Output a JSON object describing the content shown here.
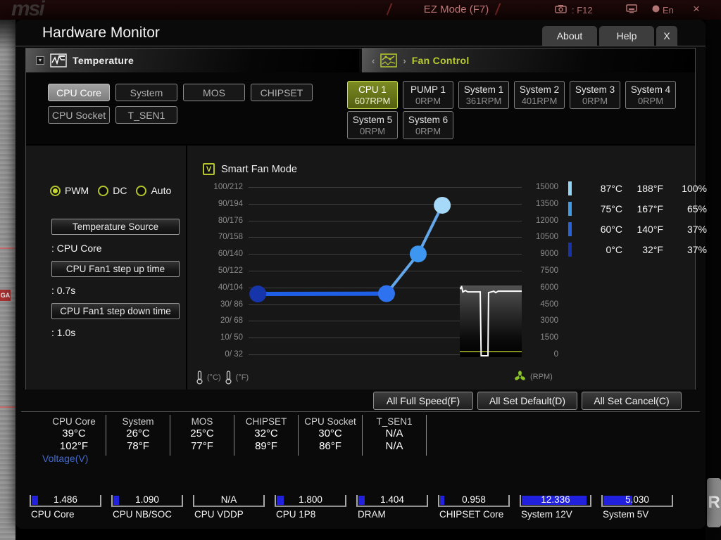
{
  "background": {
    "logo": "msi",
    "ez_mode": "EZ Mode (F7)",
    "screenshot_hint": ": F12",
    "lang": "En",
    "close_glyph": "×",
    "ga_badge": "GA",
    "r_letter": "R"
  },
  "window": {
    "title": "Hardware Monitor",
    "tabs": [
      {
        "label": "About",
        "x": false
      },
      {
        "label": "Help",
        "x": false
      },
      {
        "label": "X",
        "x": true
      }
    ]
  },
  "sections": {
    "temperature": {
      "label": "Temperature",
      "expander_glyph": "▾"
    },
    "fan_control": {
      "label": "Fan Control",
      "chev_left": "‹",
      "chev_right": "›"
    }
  },
  "temp_sensors": {
    "items": [
      {
        "label": "CPU Core",
        "selected": true
      },
      {
        "label": "System",
        "selected": false
      },
      {
        "label": "MOS",
        "selected": false
      },
      {
        "label": "CHIPSET",
        "selected": false
      },
      {
        "label": "CPU Socket",
        "selected": false
      },
      {
        "label": "T_SEN1",
        "selected": false
      }
    ]
  },
  "fans": {
    "items": [
      {
        "name": "CPU 1",
        "rpm": "607RPM",
        "selected": true
      },
      {
        "name": "PUMP 1",
        "rpm": "0RPM",
        "selected": false
      },
      {
        "name": "System 1",
        "rpm": "361RPM",
        "selected": false
      },
      {
        "name": "System 2",
        "rpm": "401RPM",
        "selected": false
      },
      {
        "name": "System 3",
        "rpm": "0RPM",
        "selected": false
      },
      {
        "name": "System 4",
        "rpm": "0RPM",
        "selected": false
      },
      {
        "name": "System 5",
        "rpm": "0RPM",
        "selected": false
      },
      {
        "name": "System 6",
        "rpm": "0RPM",
        "selected": false
      }
    ]
  },
  "fan_settings": {
    "modes": [
      {
        "label": "PWM",
        "selected": true
      },
      {
        "label": "DC",
        "selected": false
      },
      {
        "label": "Auto",
        "selected": false
      }
    ],
    "fields": [
      {
        "label": "Temperature Source",
        "value": ": CPU Core"
      },
      {
        "label": "CPU Fan1 step up time",
        "value": ": 0.7s"
      },
      {
        "label": "CPU Fan1 step down time",
        "value": ": 1.0s"
      }
    ]
  },
  "chart_data": {
    "type": "line",
    "title": "Smart Fan Mode",
    "checkbox_glyph": "V",
    "checkbox_checked": true,
    "x_axis": "temperature",
    "y_axis_left": "temperature °C/°F",
    "y_axis_right": "fan speed RPM",
    "y_left_range": [
      0,
      100
    ],
    "y_right_range": [
      0,
      15000
    ],
    "grid": true,
    "axis_rows": [
      {
        "l": "100/212",
        "r": "15000"
      },
      {
        "l": "90/194",
        "r": "13500"
      },
      {
        "l": "80/176",
        "r": "12000"
      },
      {
        "l": "70/158",
        "r": "10500"
      },
      {
        "l": "60/140",
        "r": "9000"
      },
      {
        "l": "50/122",
        "r": "7500"
      },
      {
        "l": "40/104",
        "r": "6000"
      },
      {
        "l": "30/ 86",
        "r": "4500"
      },
      {
        "l": "20/ 68",
        "r": "3000"
      },
      {
        "l": "10/ 50",
        "r": "1500"
      },
      {
        "l": "0/ 32",
        "r": "0"
      }
    ],
    "points": [
      {
        "temp_c": 0,
        "temp_f": 32,
        "fan_pct": 37,
        "color": "#1635aa",
        "px": 0.034,
        "py": 0.639
      },
      {
        "temp_c": 60,
        "temp_f": 140,
        "fan_pct": 37,
        "color": "#2e72f0",
        "px": 0.505,
        "py": 0.637
      },
      {
        "temp_c": 75,
        "temp_f": 167,
        "fan_pct": 65,
        "color": "#3d96f0",
        "px": 0.621,
        "py": 0.4
      },
      {
        "temp_c": 87,
        "temp_f": 188,
        "fan_pct": 100,
        "color": "#a6d8f8",
        "px": 0.709,
        "py": 0.109
      }
    ],
    "segment_colors": {
      "low": "#1f5fe6",
      "high": "#63a7e8"
    },
    "point_radius": 12,
    "legend_rows": [
      {
        "c": "87°C",
        "f": "188°F",
        "p": "100%",
        "color": "#90d5f5"
      },
      {
        "c": "75°C",
        "f": "167°F",
        "p": "65%",
        "color": "#3f9ae8"
      },
      {
        "c": "60°C",
        "f": "140°F",
        "p": "37%",
        "color": "#2463d8"
      },
      {
        "c": "0°C",
        "f": "32°F",
        "p": "37%",
        "color": "#1733a8"
      }
    ],
    "units": {
      "celsius": "(°C)",
      "fahrenheit": "(°F)",
      "rpm": "(RPM)"
    },
    "rpm_history": {
      "line_color": "#ffffff",
      "baseline_color": "#aab928",
      "baseline_frac": 0.92,
      "points": [
        [
          0,
          0.05
        ],
        [
          0.03,
          0.02
        ],
        [
          0.05,
          0.09
        ],
        [
          0.09,
          0.07
        ],
        [
          0.13,
          0.09
        ],
        [
          0.3,
          0.09
        ],
        [
          0.33,
          0.09
        ],
        [
          0.345,
          0.98
        ],
        [
          0.455,
          0.98
        ],
        [
          0.465,
          0.1
        ],
        [
          0.55,
          0.08
        ],
        [
          0.58,
          0.1
        ],
        [
          0.62,
          0.08
        ],
        [
          1,
          0.08
        ]
      ]
    }
  },
  "action_buttons": [
    "All Full Speed(F)",
    "All Set Default(D)",
    "All Set Cancel(C)"
  ],
  "temp_readouts": [
    {
      "name": "CPU Core",
      "c": "39°C",
      "f": "102°F"
    },
    {
      "name": "System",
      "c": "26°C",
      "f": "78°F"
    },
    {
      "name": "MOS",
      "c": "25°C",
      "f": "77°F"
    },
    {
      "name": "CHIPSET",
      "c": "32°C",
      "f": "89°F"
    },
    {
      "name": "CPU Socket",
      "c": "30°C",
      "f": "86°F"
    },
    {
      "name": "T_SEN1",
      "c": "N/A",
      "f": "N/A"
    }
  ],
  "voltage": {
    "title": "Voltage(V)",
    "items": [
      {
        "name": "CPU Core",
        "value": "1.486",
        "fill_pct": 9
      },
      {
        "name": "CPU NB/SOC",
        "value": "1.090",
        "fill_pct": 8
      },
      {
        "name": "CPU VDDP",
        "value": "N/A",
        "fill_pct": 0
      },
      {
        "name": "CPU 1P8",
        "value": "1.800",
        "fill_pct": 10
      },
      {
        "name": "DRAM",
        "value": "1.404",
        "fill_pct": 9
      },
      {
        "name": "CHIPSET Core",
        "value": "0.958",
        "fill_pct": 6
      },
      {
        "name": "System 12V",
        "value": "12.336",
        "fill_pct": 94
      },
      {
        "name": "System 5V",
        "value": "5.030",
        "fill_pct": 42
      }
    ]
  }
}
